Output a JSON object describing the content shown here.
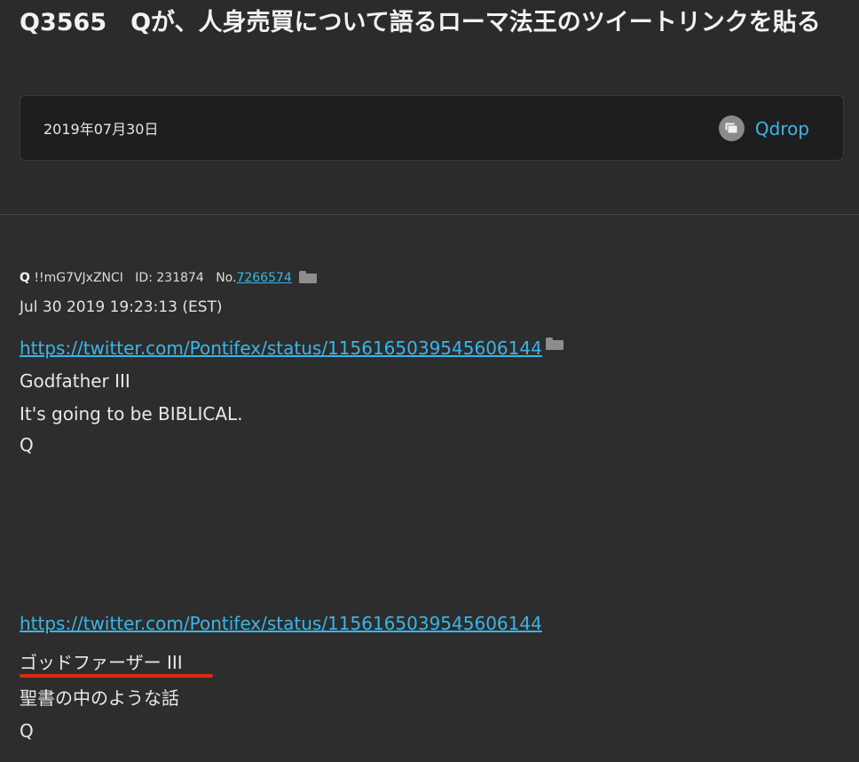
{
  "header": {
    "title": "Q3565　Qが、人身売買について語るローマ法王のツイートリンクを貼る",
    "date": "2019年07月30日",
    "category": "Qdrop",
    "category_icon": "folder-icon"
  },
  "post": {
    "author": "Q",
    "tripcode": "!!mG7VJxZNCI",
    "id_label": "ID: 231874",
    "no_label": "No.",
    "no_value": "7266574",
    "timestamp": "Jul 30 2019 19:23:13 (EST)",
    "link": "https://twitter.com/Pontifex/status/1156165039545606144",
    "lines": [
      "Godfather III",
      "It's going to be BIBLICAL.",
      "Q"
    ]
  },
  "translation": {
    "link": "https://twitter.com/Pontifex/status/1156165039545606144",
    "lines": [
      "ゴッドファーザー III",
      "聖書の中のような話",
      "Q"
    ]
  },
  "colors": {
    "accent": "#39b6e8",
    "highlight": "#dd2a10",
    "background": "#2d2d2d"
  }
}
